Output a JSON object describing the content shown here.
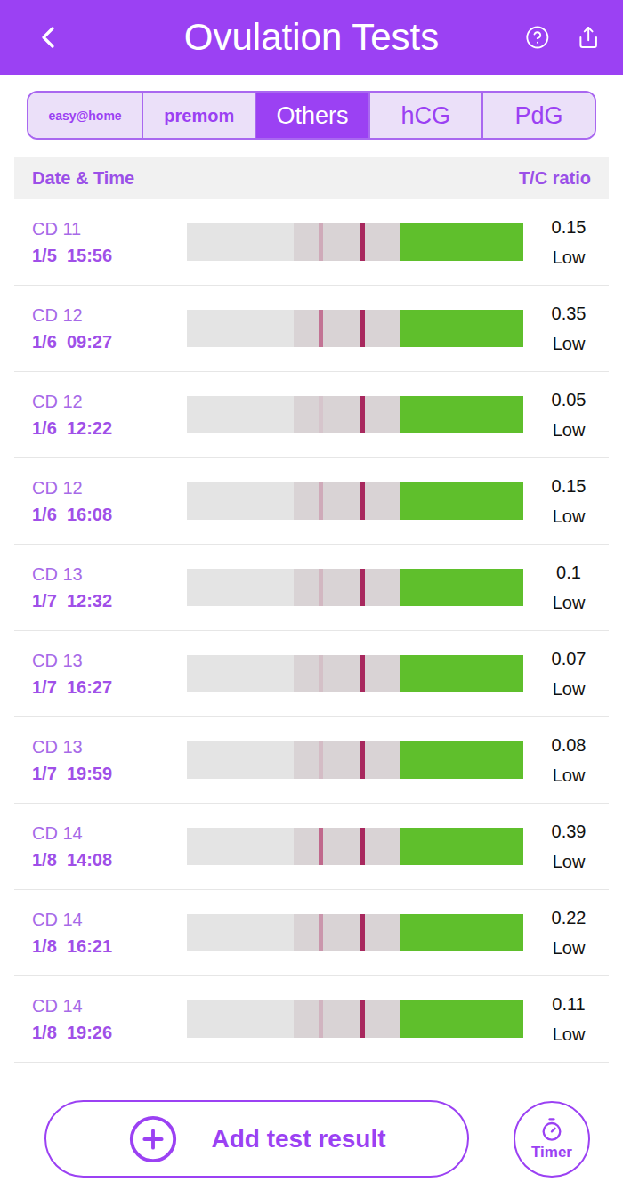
{
  "header": {
    "title": "Ovulation Tests"
  },
  "brand_tabs": [
    {
      "label": "easy@home",
      "selected": false
    },
    {
      "label": "premom",
      "selected": false
    },
    {
      "label": "Others",
      "selected": true
    },
    {
      "label": "hCG",
      "selected": false
    },
    {
      "label": "PdG",
      "selected": false
    }
  ],
  "table": {
    "columns": [
      "Date & Time",
      "T/C ratio"
    ],
    "rows": [
      {
        "cycle_day": "CD 11",
        "date": "1/5",
        "time": "15:56",
        "ratio": "0.15",
        "result": "Low"
      },
      {
        "cycle_day": "CD 12",
        "date": "1/6",
        "time": "09:27",
        "ratio": "0.35",
        "result": "Low"
      },
      {
        "cycle_day": "CD 12",
        "date": "1/6",
        "time": "12:22",
        "ratio": "0.05",
        "result": "Low"
      },
      {
        "cycle_day": "CD 12",
        "date": "1/6",
        "time": "16:08",
        "ratio": "0.15",
        "result": "Low"
      },
      {
        "cycle_day": "CD 13",
        "date": "1/7",
        "time": "12:32",
        "ratio": "0.1",
        "result": "Low"
      },
      {
        "cycle_day": "CD 13",
        "date": "1/7",
        "time": "16:27",
        "ratio": "0.07",
        "result": "Low"
      },
      {
        "cycle_day": "CD 13",
        "date": "1/7",
        "time": "19:59",
        "ratio": "0.08",
        "result": "Low"
      },
      {
        "cycle_day": "CD 14",
        "date": "1/8",
        "time": "14:08",
        "ratio": "0.39",
        "result": "Low"
      },
      {
        "cycle_day": "CD 14",
        "date": "1/8",
        "time": "16:21",
        "ratio": "0.22",
        "result": "Low"
      },
      {
        "cycle_day": "CD 14",
        "date": "1/8",
        "time": "19:26",
        "ratio": "0.11",
        "result": "Low"
      }
    ]
  },
  "add_button": {
    "label": "Add test result"
  },
  "timer": {
    "label": "Timer"
  }
}
